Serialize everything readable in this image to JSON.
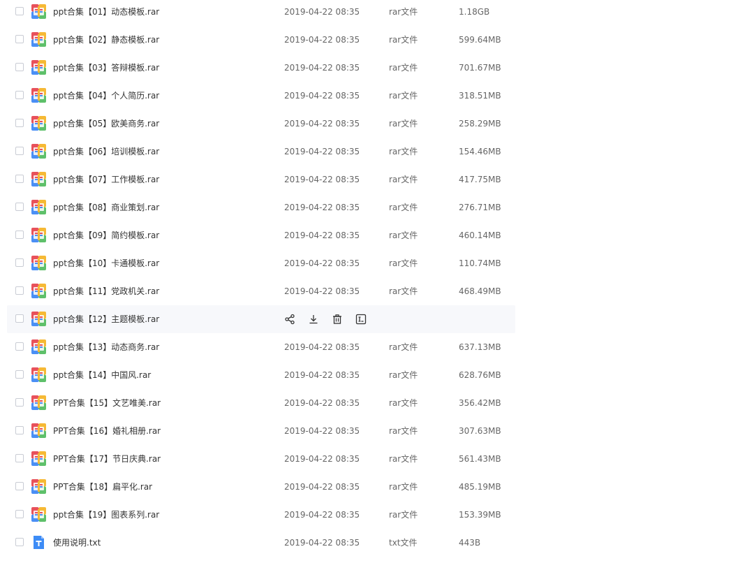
{
  "files": [
    {
      "name": "ppt合集【01】动态模板.rar",
      "date": "2019-04-22 08:35",
      "type": "rar文件",
      "size": "1.18GB",
      "icon": "rar-archive-icon"
    },
    {
      "name": "ppt合集【02】静态模板.rar",
      "date": "2019-04-22 08:35",
      "type": "rar文件",
      "size": "599.64MB",
      "icon": "rar-archive-icon"
    },
    {
      "name": "ppt合集【03】答辩模板.rar",
      "date": "2019-04-22 08:35",
      "type": "rar文件",
      "size": "701.67MB",
      "icon": "rar-archive-icon"
    },
    {
      "name": "ppt合集【04】个人简历.rar",
      "date": "2019-04-22 08:35",
      "type": "rar文件",
      "size": "318.51MB",
      "icon": "rar-archive-icon"
    },
    {
      "name": "ppt合集【05】欧美商务.rar",
      "date": "2019-04-22 08:35",
      "type": "rar文件",
      "size": "258.29MB",
      "icon": "rar-archive-icon"
    },
    {
      "name": "ppt合集【06】培训模板.rar",
      "date": "2019-04-22 08:35",
      "type": "rar文件",
      "size": "154.46MB",
      "icon": "rar-archive-icon"
    },
    {
      "name": "ppt合集【07】工作模板.rar",
      "date": "2019-04-22 08:35",
      "type": "rar文件",
      "size": "417.75MB",
      "icon": "rar-archive-icon"
    },
    {
      "name": "ppt合集【08】商业策划.rar",
      "date": "2019-04-22 08:35",
      "type": "rar文件",
      "size": "276.71MB",
      "icon": "rar-archive-icon"
    },
    {
      "name": "ppt合集【09】简约模板.rar",
      "date": "2019-04-22 08:35",
      "type": "rar文件",
      "size": "460.14MB",
      "icon": "rar-archive-icon"
    },
    {
      "name": "ppt合集【10】卡通模板.rar",
      "date": "2019-04-22 08:35",
      "type": "rar文件",
      "size": "110.74MB",
      "icon": "rar-archive-icon"
    },
    {
      "name": "ppt合集【11】党政机关.rar",
      "date": "2019-04-22 08:35",
      "type": "rar文件",
      "size": "468.49MB",
      "icon": "rar-archive-icon"
    },
    {
      "name": "ppt合集【12】主题模板.rar",
      "date": "",
      "type": "",
      "size": "",
      "icon": "rar-archive-icon",
      "hovered": true
    },
    {
      "name": "ppt合集【13】动态商务.rar",
      "date": "2019-04-22 08:35",
      "type": "rar文件",
      "size": "637.13MB",
      "icon": "rar-archive-icon"
    },
    {
      "name": "ppt合集【14】中国风.rar",
      "date": "2019-04-22 08:35",
      "type": "rar文件",
      "size": "628.76MB",
      "icon": "rar-archive-icon"
    },
    {
      "name": "PPT合集【15】文艺唯美.rar",
      "date": "2019-04-22 08:35",
      "type": "rar文件",
      "size": "356.42MB",
      "icon": "rar-archive-icon"
    },
    {
      "name": "PPT合集【16】婚礼相册.rar",
      "date": "2019-04-22 08:35",
      "type": "rar文件",
      "size": "307.63MB",
      "icon": "rar-archive-icon"
    },
    {
      "name": "PPT合集【17】节日庆典.rar",
      "date": "2019-04-22 08:35",
      "type": "rar文件",
      "size": "561.43MB",
      "icon": "rar-archive-icon"
    },
    {
      "name": "PPT合集【18】扁平化.rar",
      "date": "2019-04-22 08:35",
      "type": "rar文件",
      "size": "485.19MB",
      "icon": "rar-archive-icon"
    },
    {
      "name": "ppt合集【19】图表系列.rar",
      "date": "2019-04-22 08:35",
      "type": "rar文件",
      "size": "153.39MB",
      "icon": "rar-archive-icon"
    },
    {
      "name": "使用说明.txt",
      "date": "2019-04-22 08:35",
      "type": "txt文件",
      "size": "443B",
      "icon": "txt-document-icon"
    }
  ],
  "hover_actions": [
    {
      "name": "share-icon"
    },
    {
      "name": "download-icon"
    },
    {
      "name": "delete-icon"
    },
    {
      "name": "rename-icon"
    }
  ],
  "colors": {
    "hover_row_bg": "#f7f8fb",
    "rar_red": "#e8515b",
    "rar_yellow": "#f6b935",
    "rar_blue": "#4a8ff5",
    "rar_green": "#5ec06a",
    "txt_blue": "#3d8cf6"
  }
}
